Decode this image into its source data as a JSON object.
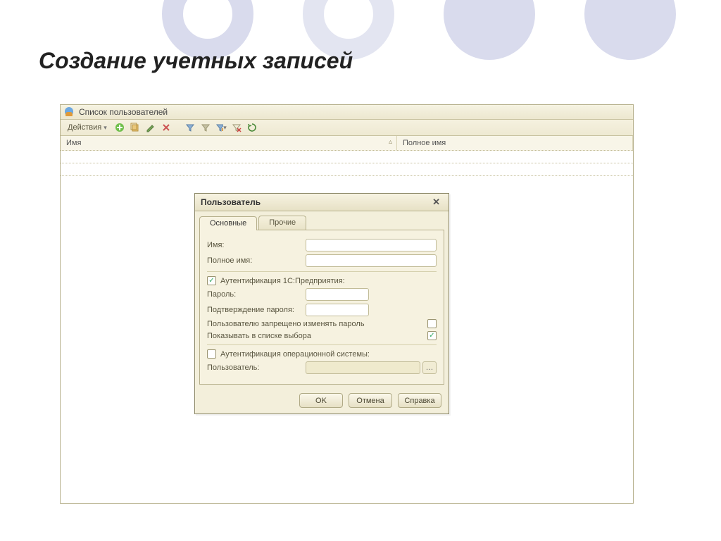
{
  "slide": {
    "title": "Создание учетных записей"
  },
  "listWindow": {
    "title": "Список пользователей",
    "actionsLabel": "Действия",
    "columns": {
      "name": "Имя",
      "fullname": "Полное имя"
    }
  },
  "dialog": {
    "title": "Пользователь",
    "tabs": {
      "main": "Основные",
      "other": "Прочие"
    },
    "fields": {
      "name": "Имя:",
      "fullname": "Полное имя:",
      "auth1c": "Аутентификация 1С:Предприятия:",
      "password": "Пароль:",
      "confirm": "Подтверждение пароля:",
      "forbidChange": "Пользователю запрещено изменять пароль",
      "showInList": "Показывать в списке выбора",
      "authOs": "Аутентификация операционной системы:",
      "osUser": "Пользователь:"
    },
    "values": {
      "name": "",
      "fullname": "",
      "password": "",
      "confirm": "",
      "osUser": "",
      "auth1cChecked": true,
      "forbidChangeChecked": false,
      "showInListChecked": true,
      "authOsChecked": false
    },
    "buttons": {
      "ok": "OK",
      "cancel": "Отмена",
      "help": "Справка"
    }
  }
}
